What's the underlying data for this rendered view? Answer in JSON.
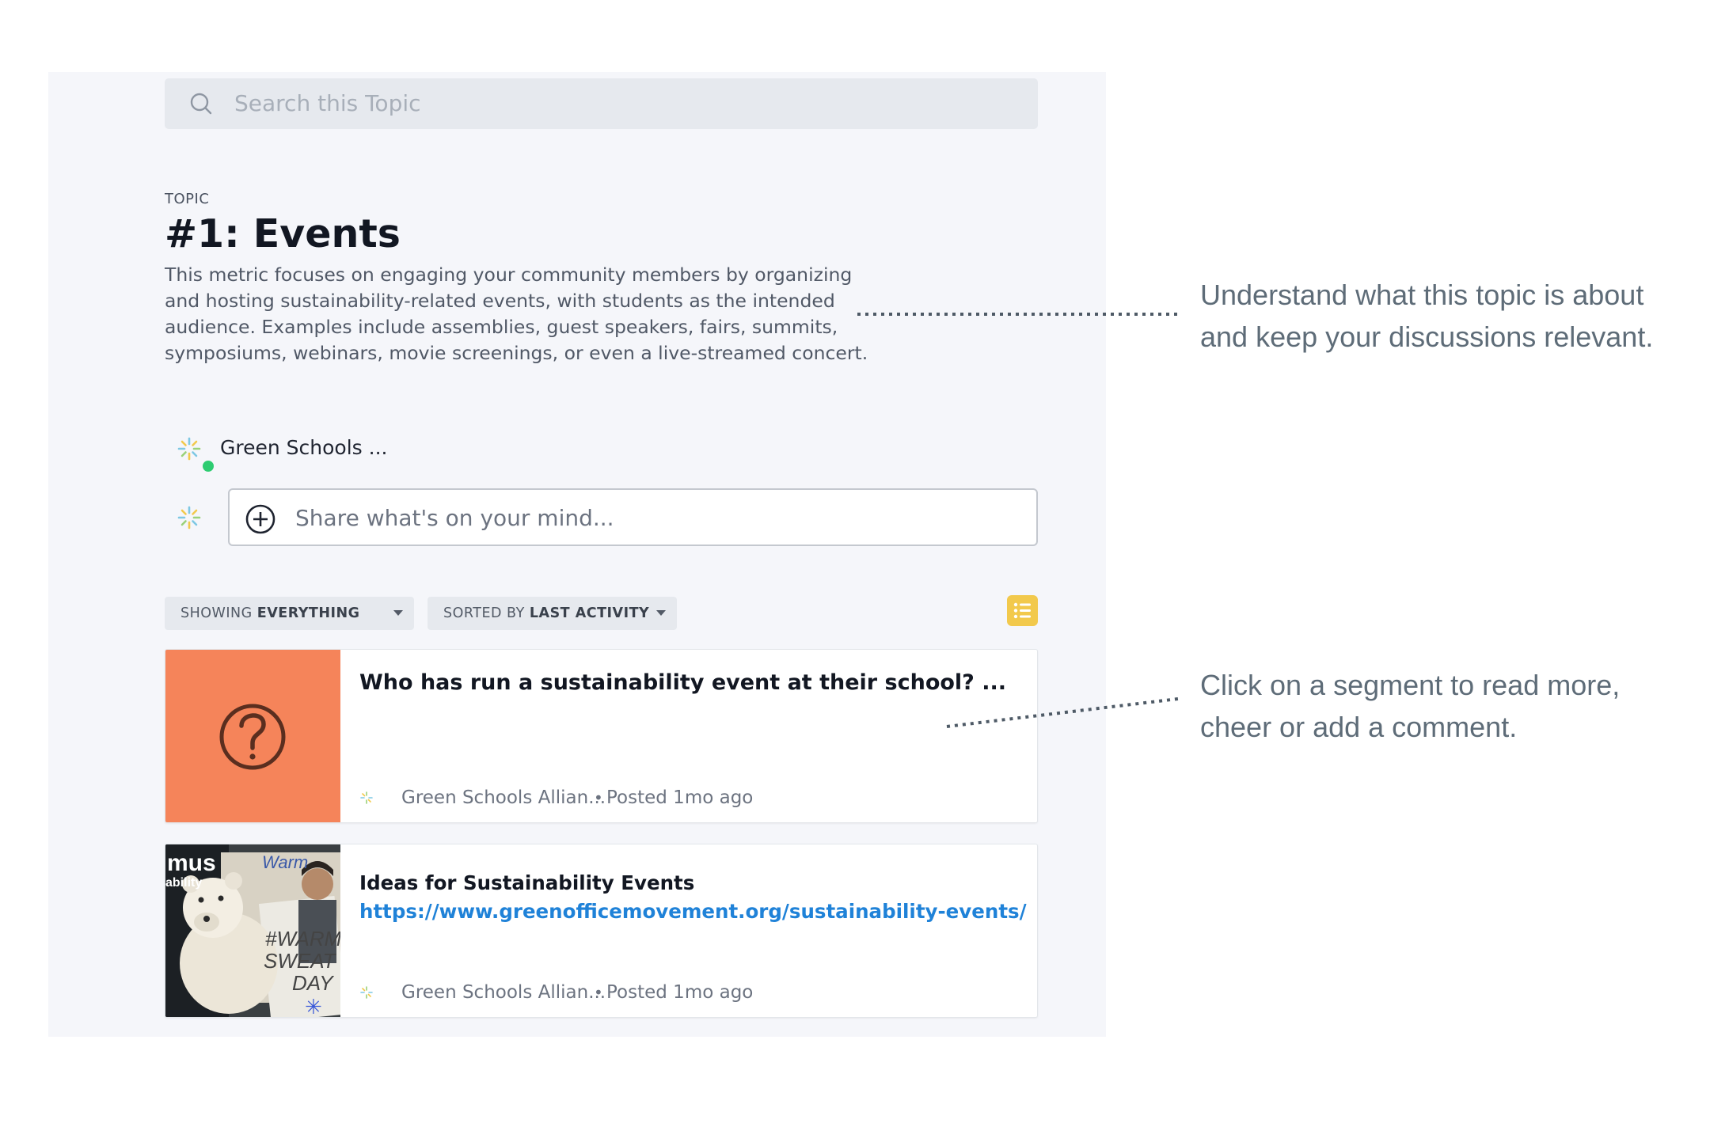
{
  "search": {
    "placeholder": "Search this Topic"
  },
  "topic": {
    "label": "TOPIC",
    "title": "#1: Events",
    "description": "This metric focuses on engaging your community members by organizing and hosting sustainability-related events, with students as the intended audience. Examples include assemblies, guest speakers, fairs, summits, symposiums, webinars, movie screenings, or even a live-streamed concert."
  },
  "author": {
    "name": "Green Schools ...",
    "status": "online"
  },
  "composer": {
    "placeholder": "Share what's on your mind..."
  },
  "filters": {
    "showing_prefix": "SHOWING",
    "showing_value": "EVERYTHING",
    "sorted_prefix": "SORTED BY",
    "sorted_value": "LAST ACTIVITY"
  },
  "posts": [
    {
      "title": "Who has run a sustainability event at their school? ...",
      "author": "Green Schools Allian...",
      "separator": "•",
      "posted": "Posted 1mo ago",
      "thumb_color": "#f5845a",
      "icon": "question-icon"
    },
    {
      "title": "Ideas for Sustainability Events",
      "link": "https://www.greenofficemovement.org/sustainability-events/",
      "author": "Green Schools Allian...",
      "separator": "•",
      "posted": "Posted 1mo ago",
      "icon": "photo-thumbnail"
    }
  ],
  "callouts": [
    "Understand what this topic is about and keep your discussions relevant.",
    "Click on a segment to read more, cheer or add a comment."
  ],
  "colors": {
    "panel_bg": "#f5f6fa",
    "accent_yellow": "#f2c94c",
    "link_blue": "#1f82d8",
    "online_green": "#2ecc71",
    "question_orange": "#f5845a"
  }
}
